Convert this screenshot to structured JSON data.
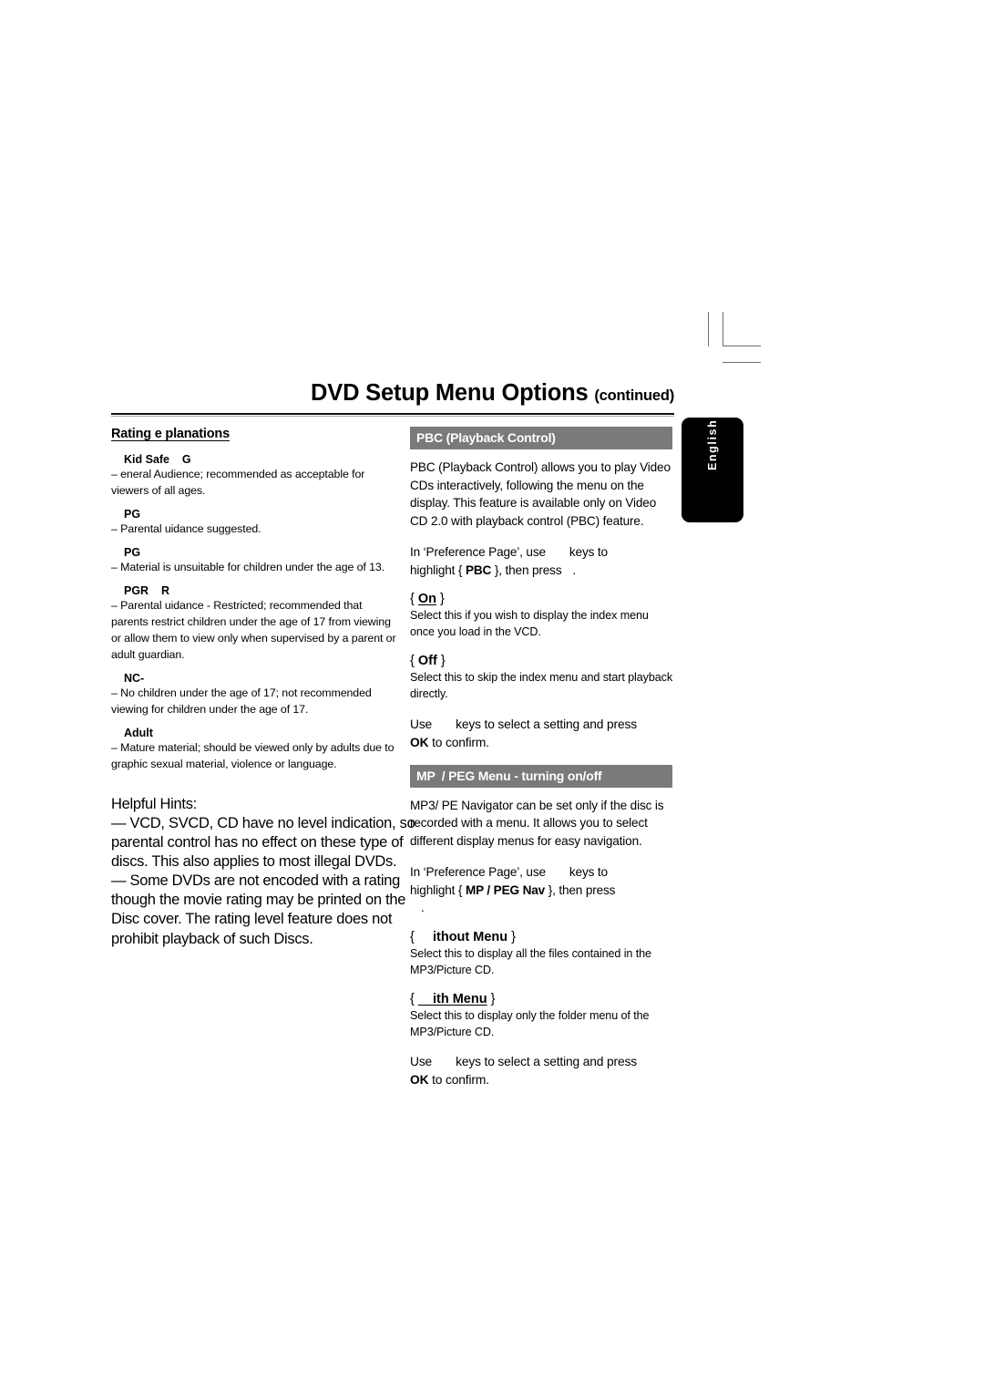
{
  "page": {
    "title_main": "DVD Setup Menu Options",
    "title_cont": "(continued)",
    "language_tab": "English"
  },
  "left_column": {
    "section_heading": "Rating e planations",
    "ratings": [
      {
        "name": "Kid Safe    G",
        "desc": "–      eneral Audience; recommended as acceptable for viewers of all ages."
      },
      {
        "name": "PG",
        "desc": "–  Parental    uidance suggested."
      },
      {
        "name": "PG",
        "desc": "–  Material is unsuitable for children under the age of 13."
      },
      {
        "name": "PGR    R",
        "desc": "–  Parental    uidance - Restricted; recommended that parents restrict children under the age of 17 from viewing or allow them to view only when supervised by a parent or adult guardian."
      },
      {
        "name": "NC-",
        "desc": "–  No children under the age of 17; not recommended viewing for children under the age of 17."
      },
      {
        "name": "Adult",
        "desc": "–  Mature material; should be viewed only by adults due to graphic sexual material, violence or language."
      }
    ],
    "hints_title": "Helpful Hints:",
    "hints": [
      "— VCD, SVCD, CD have no level indication, so parental control has no effect on these type of discs. This also applies to most illegal DVDs.",
      "— Some DVDs are not encoded with a rating though the movie rating may be printed on the Disc cover. The rating level feature does not prohibit playback of such Discs."
    ]
  },
  "right_column": {
    "pbc": {
      "bar_label": "PBC (Playback Control)",
      "intro": "PBC (Playback Control) allows you to play Video CDs interactively, following the menu on the display. This feature is available only on Video CD 2.0 with playback control (PBC) feature.",
      "instruction_line1_a": "In ‘Preference Page’, use",
      "instruction_line1_b": "keys to",
      "instruction_line2_a": "highlight {",
      "instruction_line2_b": "PBC",
      "instruction_line2_c": "}, then press",
      "instruction_line2_d": ".",
      "options": [
        {
          "label_open": "{",
          "label_bold": "On",
          "label_close": "}",
          "underlined": true,
          "desc": "Select this if you wish to display the index menu once you load in the VCD."
        },
        {
          "label_open": "{",
          "label_bold": "Off",
          "label_close": "}",
          "underlined": false,
          "desc": "Select this to skip the index menu and start playback directly."
        }
      ],
      "use_a": "Use",
      "use_b": "keys to select a setting and press",
      "use_c": "OK",
      "use_d": "to confirm."
    },
    "mp3": {
      "bar_label": "MP  / PEG Menu - turning on/off",
      "intro": "MP3/ PE     Navigator can be set only if the disc is recorded with a menu.  It allows you to select different display menus for easy navigation.",
      "instruction_line1_a": "In ‘Preference Page’, use",
      "instruction_line1_b": "keys to",
      "instruction_line2_a": "highlight {",
      "instruction_line2_b": "MP  / PEG Nav",
      "instruction_line2_c": "}, then press",
      "instruction_line2_d": ".",
      "options": [
        {
          "label_open": "{",
          "label_bold": "    ithout Menu",
          "label_close": "}",
          "underlined": false,
          "desc": "Select this to display all the files contained in the MP3/Picture CD."
        },
        {
          "label_open": "{",
          "label_bold": "    ith Menu",
          "label_close": "}",
          "underlined": true,
          "desc": "Select this to display only the folder menu of the MP3/Picture CD."
        }
      ],
      "use_a": "Use",
      "use_b": "keys to select a setting and press",
      "use_c": "OK",
      "use_d": "to confirm."
    }
  }
}
